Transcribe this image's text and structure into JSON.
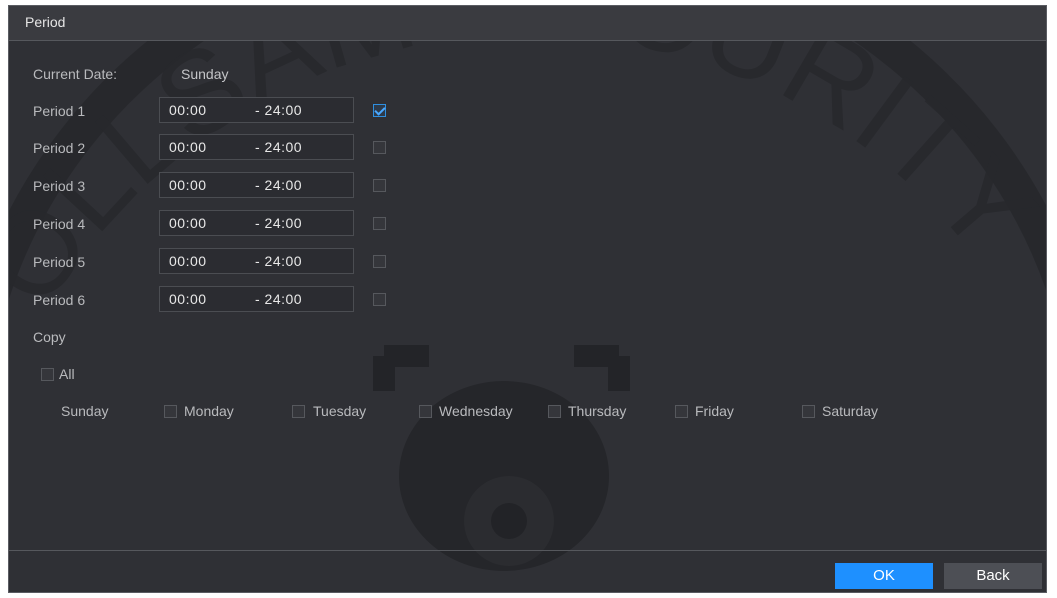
{
  "dialog": {
    "title": "Period"
  },
  "current_date": {
    "label": "Current Date:",
    "value": "Sunday"
  },
  "periods": [
    {
      "label": "Period 1",
      "start": "00:00",
      "end": "- 24:00",
      "checked": true
    },
    {
      "label": "Period 2",
      "start": "00:00",
      "end": "- 24:00",
      "checked": false
    },
    {
      "label": "Period 3",
      "start": "00:00",
      "end": "- 24:00",
      "checked": false
    },
    {
      "label": "Period 4",
      "start": "00:00",
      "end": "- 24:00",
      "checked": false
    },
    {
      "label": "Period 5",
      "start": "00:00",
      "end": "- 24:00",
      "checked": false
    },
    {
      "label": "Period 6",
      "start": "00:00",
      "end": "- 24:00",
      "checked": false
    }
  ],
  "copy": {
    "label": "Copy",
    "all_label": "All",
    "days": [
      {
        "label": "Sunday",
        "has_checkbox": false
      },
      {
        "label": "Monday",
        "has_checkbox": true
      },
      {
        "label": "Tuesday",
        "has_checkbox": true
      },
      {
        "label": "Wednesday",
        "has_checkbox": true
      },
      {
        "label": "Thursday",
        "has_checkbox": true
      },
      {
        "label": "Friday",
        "has_checkbox": true
      },
      {
        "label": "Saturday",
        "has_checkbox": true
      }
    ]
  },
  "buttons": {
    "ok": "OK",
    "back": "Back"
  },
  "watermark": {
    "text": "OLLSAM SECURITY"
  },
  "colors": {
    "background": "#2f3035",
    "accent": "#1e90ff",
    "check": "#4aa8ff"
  }
}
